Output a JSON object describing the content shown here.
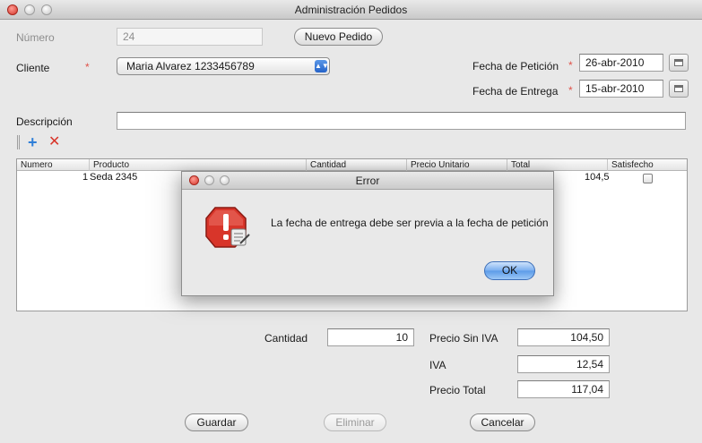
{
  "window": {
    "title": "Administración Pedidos"
  },
  "form": {
    "numero_label": "Número",
    "numero_value": "24",
    "nuevo_pedido_label": "Nuevo Pedido",
    "cliente_label": "Cliente",
    "required_mark": "*",
    "cliente_value": "Maria Alvarez 1233456789",
    "fecha_peticion_label": "Fecha de Petición",
    "fecha_peticion_value": "26-abr-2010",
    "fecha_entrega_label": "Fecha de Entrega",
    "fecha_entrega_value": "15-abr-2010",
    "descripcion_label": "Descripción",
    "descripcion_value": ""
  },
  "toolbar": {
    "add_icon": "plus-icon",
    "delete_icon": "delete-x-icon"
  },
  "table": {
    "columns": [
      "Numero",
      "Producto",
      "Cantidad",
      "Precio Unitario",
      "Total",
      "Satisfecho"
    ],
    "rows": [
      {
        "numero": "1",
        "producto": "Seda 2345",
        "total": "104,5",
        "satisfecho": false
      }
    ]
  },
  "totals": {
    "cantidad_label": "Cantidad",
    "cantidad_value": "10",
    "precio_sin_iva_label": "Precio Sin IVA",
    "precio_sin_iva_value": "104,50",
    "iva_label": "IVA",
    "iva_value": "12,54",
    "precio_total_label": "Precio Total",
    "precio_total_value": "117,04"
  },
  "actions": {
    "guardar": "Guardar",
    "eliminar": "Eliminar",
    "cancelar": "Cancelar"
  },
  "dialog": {
    "title": "Error",
    "message": "La fecha de entrega debe ser previa a la fecha de petición",
    "ok_label": "OK",
    "icon": "stop-warning-icon"
  },
  "colors": {
    "accent": "#5b9be8",
    "error": "#d3362b",
    "required": "#e0524a"
  }
}
